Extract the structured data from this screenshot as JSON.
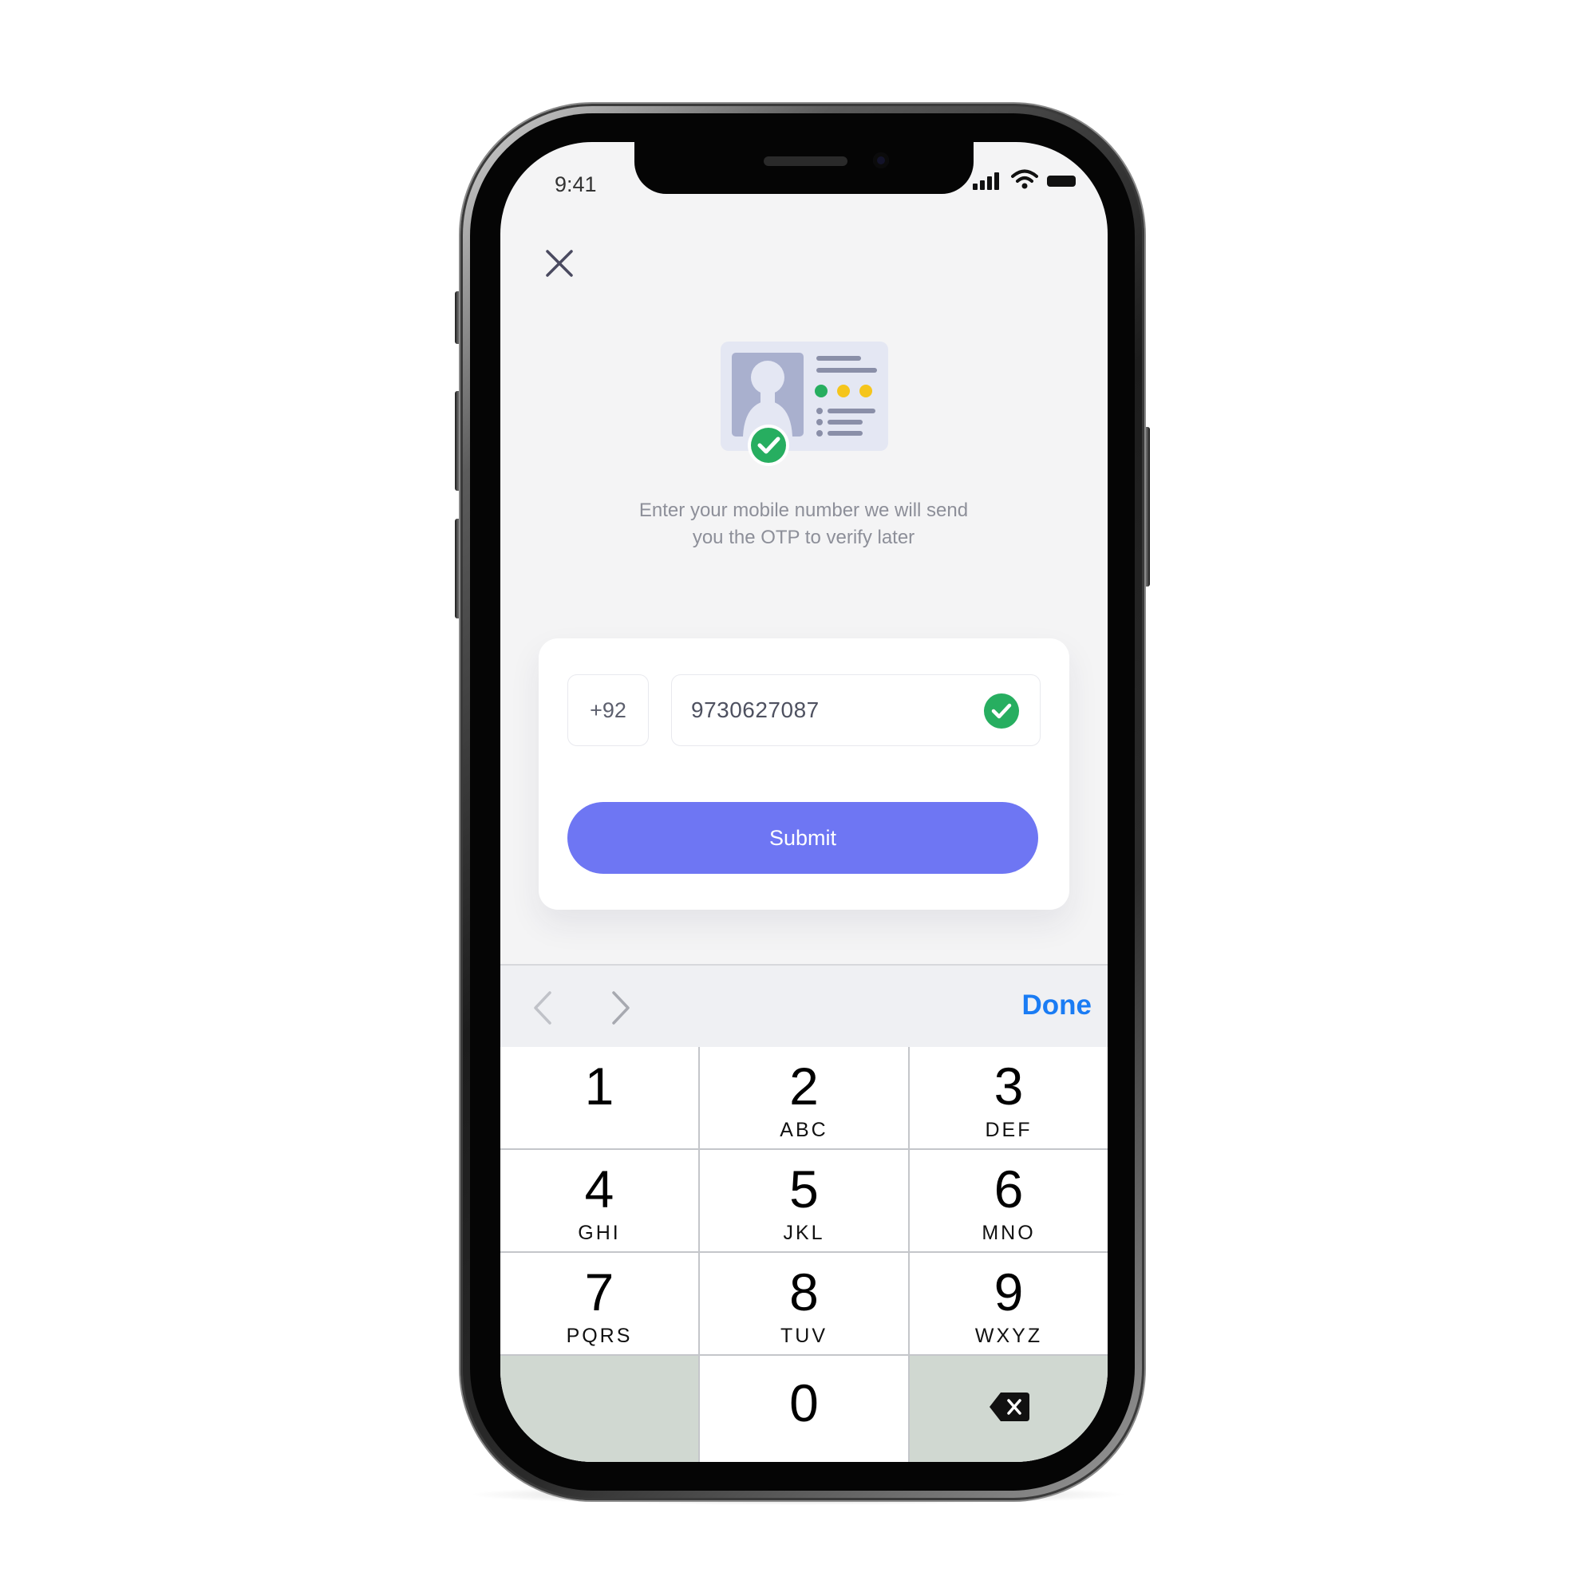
{
  "status_bar": {
    "time": "9:41",
    "icons": [
      "signal-icon",
      "wifi-icon",
      "battery-icon"
    ]
  },
  "header": {
    "close_icon": "close-icon"
  },
  "illustration": {
    "icon": "id-card-verified-icon",
    "accent_colors": [
      "#27ae60",
      "#f5c51c",
      "#8f95b2"
    ]
  },
  "description": {
    "line1": "Enter your mobile number we will send",
    "line2": "you the OTP to verify later"
  },
  "form": {
    "country_code": "+92",
    "phone_number": "9730627087",
    "valid_icon": "check-circle-icon",
    "submit_label": "Submit"
  },
  "keyboard_toolbar": {
    "prev_icon": "chevron-left-icon",
    "next_icon": "chevron-right-icon",
    "done_label": "Done"
  },
  "keypad": {
    "keys": [
      {
        "num": "1",
        "letters": ""
      },
      {
        "num": "2",
        "letters": "ABC"
      },
      {
        "num": "3",
        "letters": "DEF"
      },
      {
        "num": "4",
        "letters": "GHI"
      },
      {
        "num": "5",
        "letters": "JKL"
      },
      {
        "num": "6",
        "letters": "MNO"
      },
      {
        "num": "7",
        "letters": "PQRS"
      },
      {
        "num": "8",
        "letters": "TUV"
      },
      {
        "num": "9",
        "letters": "WXYZ"
      },
      {
        "num": "0",
        "letters": ""
      }
    ],
    "delete_icon": "backspace-icon"
  },
  "colors": {
    "accent": "#6e76f3",
    "success": "#27ae60",
    "link": "#1a7cf4"
  }
}
